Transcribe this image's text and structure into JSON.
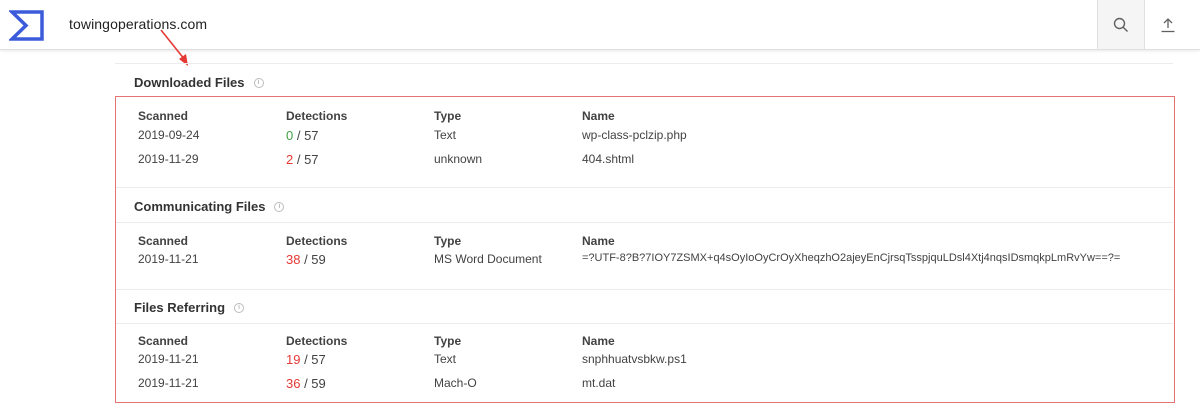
{
  "header": {
    "search_value": "towingoperations.com",
    "logo_icon": "sigma-logo-icon",
    "search_icon": "search-icon",
    "upload_icon": "upload-icon",
    "brand_color": "#3b5bdb"
  },
  "table_headers": {
    "scanned": "Scanned",
    "detections": "Detections",
    "type": "Type",
    "name": "Name"
  },
  "sections": [
    {
      "title": "Downloaded Files",
      "rows": [
        {
          "scanned": "2019-09-24",
          "detected": "0",
          "total": " / 57",
          "type": "Text",
          "name": "wp-class-pclzip.php"
        },
        {
          "scanned": "2019-11-29",
          "detected": "2",
          "total": " / 57",
          "type": "unknown",
          "name": "404.shtml"
        }
      ]
    },
    {
      "title": "Communicating Files",
      "rows": [
        {
          "scanned": "2019-11-21",
          "detected": "38",
          "total": " / 59",
          "type": "MS Word Document",
          "name": "=?UTF-8?B?7IOY7ZSMX+q4sOyIoOyCrOyXheqzhO2ajeyEnCjrsqTsspjquLDsl4Xtj4nqsIDsmqkpLmRvYw==?="
        }
      ]
    },
    {
      "title": "Files Referring",
      "rows": [
        {
          "scanned": "2019-11-21",
          "detected": "19",
          "total": " / 57",
          "type": "Text",
          "name": "snphhuatvsbkw.ps1"
        },
        {
          "scanned": "2019-11-21",
          "detected": "36",
          "total": " / 59",
          "type": "Mach-O",
          "name": "mt.dat"
        }
      ]
    }
  ],
  "colors": {
    "detection_positive": "#e53935",
    "detection_clean": "#43a047",
    "annotation_red": "#e53935"
  }
}
